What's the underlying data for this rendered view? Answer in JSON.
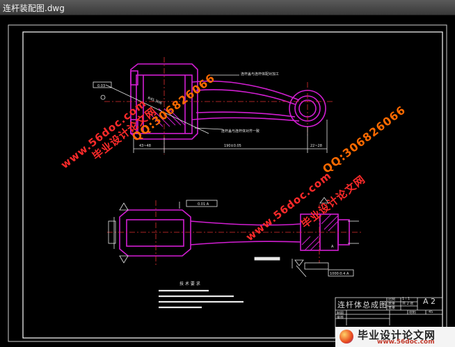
{
  "window": {
    "title": "连杆装配图.dwg"
  },
  "drawing": {
    "title_block": {
      "title": "连杆体总成图",
      "sheet_size": "A 2",
      "scale_label": "比例",
      "scale_value": "1 : 1",
      "material_label": "材料",
      "material_value": "45",
      "row2_label": "数量",
      "row2_value": "共 2 张",
      "row3_label": "重量",
      "drawn_label": "制图",
      "checked_label": "审核"
    },
    "tech_requirements": {
      "heading": "技 术 要 求"
    },
    "annotations": {
      "note_top": "连杆盖与连杆体配对加工",
      "note_mid": "连杆盖与连杆体对齐一致",
      "dim_left": "43~48",
      "dim_center": "190±0.05",
      "dim_right": "22~28",
      "tol_top": "0.03",
      "tol_center": "0.01 A",
      "tol_bottom": "1000:0.4 A",
      "dia_label": "R45.3H6",
      "view_label": "A"
    }
  },
  "watermarks": {
    "site_cn": "毕业设计论文网",
    "site_url": "www.56doc.com",
    "qq": "QQ:306826066"
  },
  "logo": {
    "name": "毕业设计论文网",
    "url": "www.56doc.com"
  },
  "colors": {
    "frame": "#ffffff",
    "part": "#d21ed2",
    "dim": "#e8e8e8",
    "watermark_red": "#ff2a2a",
    "watermark_orange": "#ff6a00"
  }
}
